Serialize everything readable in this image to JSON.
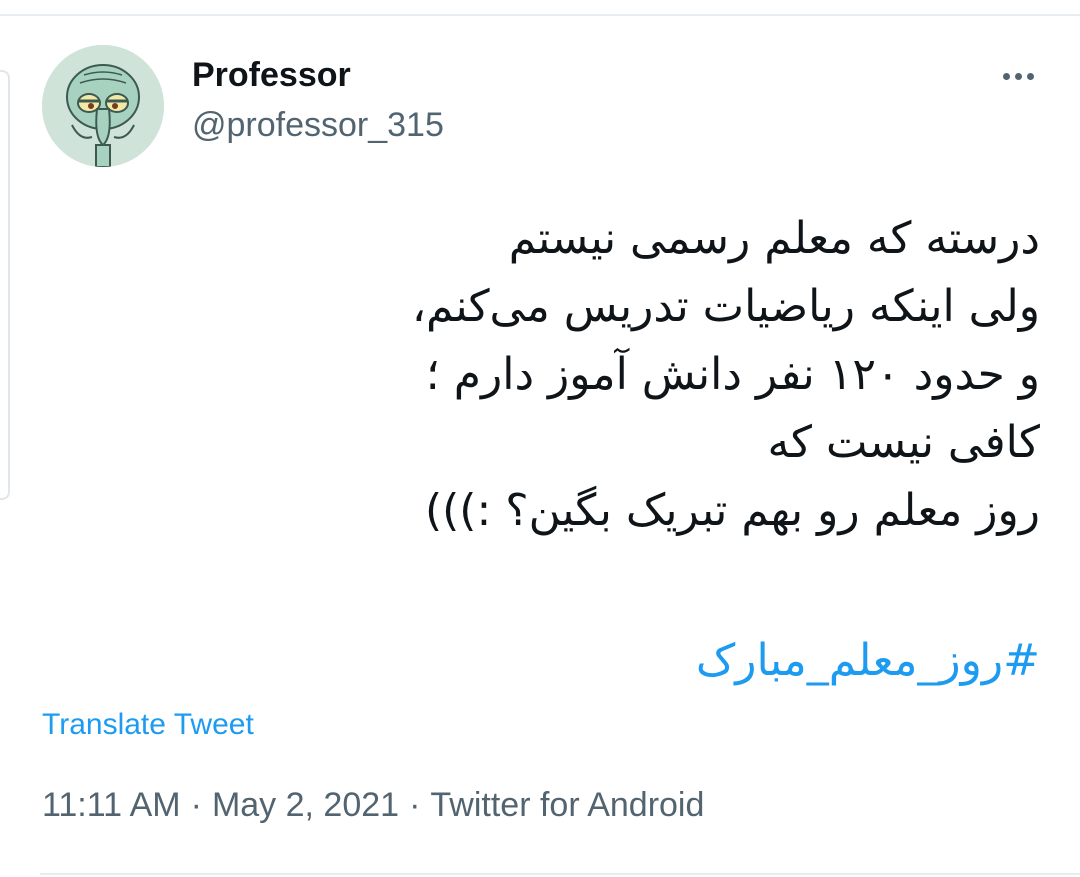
{
  "author": {
    "display_name": "Professor",
    "handle": "@professor_315",
    "avatar_icon": "cartoon-face-avatar"
  },
  "tweet": {
    "lines": [
      "درسته که معلم رسمی نیستم",
      "ولی اینکه ریاضیات تدریس می‌کنم،",
      "و حدود ۱۲۰ نفر دانش آموز دارم ؛",
      "کافی نیست که",
      "روز معلم رو بهم تبریک بگین؟ :)))"
    ],
    "hashtag": "#روز_معلم_مبارک",
    "translate_label": "Translate Tweet"
  },
  "meta": {
    "time": "11:11 AM",
    "separator": "·",
    "date": "May 2, 2021",
    "source": "Twitter for Android"
  },
  "colors": {
    "link": "#1d9bf0",
    "secondary_text": "#536471",
    "primary_text": "#0f1419",
    "divider": "#e6ecf0"
  },
  "icons": {
    "more": "more-options-icon"
  }
}
